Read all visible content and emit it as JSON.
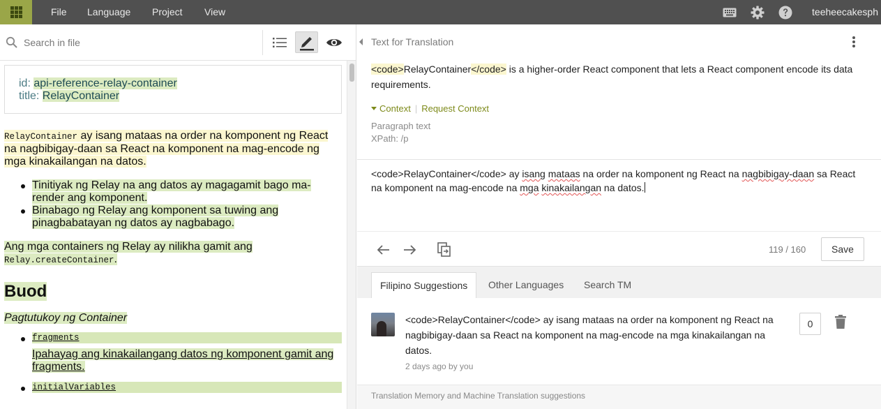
{
  "topbar": {
    "menu": [
      "File",
      "Language",
      "Project",
      "View"
    ],
    "username": "teeheecakesph",
    "icons": [
      "apps-grid-icon",
      "keyboard-icon",
      "gear-icon",
      "help-icon"
    ]
  },
  "left": {
    "search_placeholder": "Search in file",
    "front_matter": {
      "id_key": "id:",
      "id_value": "api-reference-relay-container",
      "title_key": "title:",
      "title_value": "RelayContainer"
    },
    "intro_code": "RelayContainer",
    "intro_text": " ay isang mataas na order na komponent ng React na nagbibigay-daan sa React na komponent na mag-encode ng mga kinakailangan na datos.",
    "bullets": [
      "Tinitiyak ng Relay na ang datos ay magagamit bago ma-render ang komponent.",
      "Binabago ng Relay ang komponent sa tuwing ang pinagbabatayan ng datos ay nagbabago."
    ],
    "containers_text": "Ang mga containers ng Relay ay nilikha gamit ang",
    "containers_code": "Relay.createContainer",
    "containers_end": ".",
    "heading": "Buod",
    "subheading": "Pagtutukoy ng Container",
    "spec_items": [
      {
        "code": "fragments",
        "desc": "Ipahayag ang kinakailangang datos ng komponent gamit ang fragments."
      },
      {
        "code": "initialVariables",
        "desc": ""
      }
    ]
  },
  "right": {
    "source_heading": "Text for Translation",
    "source": {
      "tag_open": "<code>",
      "name": "RelayContainer",
      "tag_close": "</code>",
      "rest": " is a higher-order React component that lets a React component encode its data requirements."
    },
    "context_label": "Context",
    "request_context_label": "Request Context",
    "context_type": "Paragraph text",
    "xpath": "XPath: /p",
    "translation": {
      "p1": "<code>RelayContainer</code> ay ",
      "w1": "isang",
      "p2": " ",
      "w2": "mataas",
      "p3": " na order na komponent ng React na ",
      "w3": "nagbibigay-daan",
      "p4": " sa React na komponent na mag-encode na ",
      "w4": "mga",
      "p5": " ",
      "w5": "kinakailangan",
      "p6": " na datos."
    },
    "counter": "119 / 160",
    "save_label": "Save",
    "tabs": [
      "Filipino Suggestions",
      "Other Languages",
      "Search TM"
    ],
    "suggestion": {
      "text": "<code>RelayContainer</code> ay isang mataas na order na komponent ng React na nagbibigay-daan sa React na komponent na mag-encode na mga kinakailangan na datos.",
      "meta": "2 days ago by you",
      "votes": "0"
    },
    "tm_note": "Translation Memory and Machine Translation suggestions"
  }
}
